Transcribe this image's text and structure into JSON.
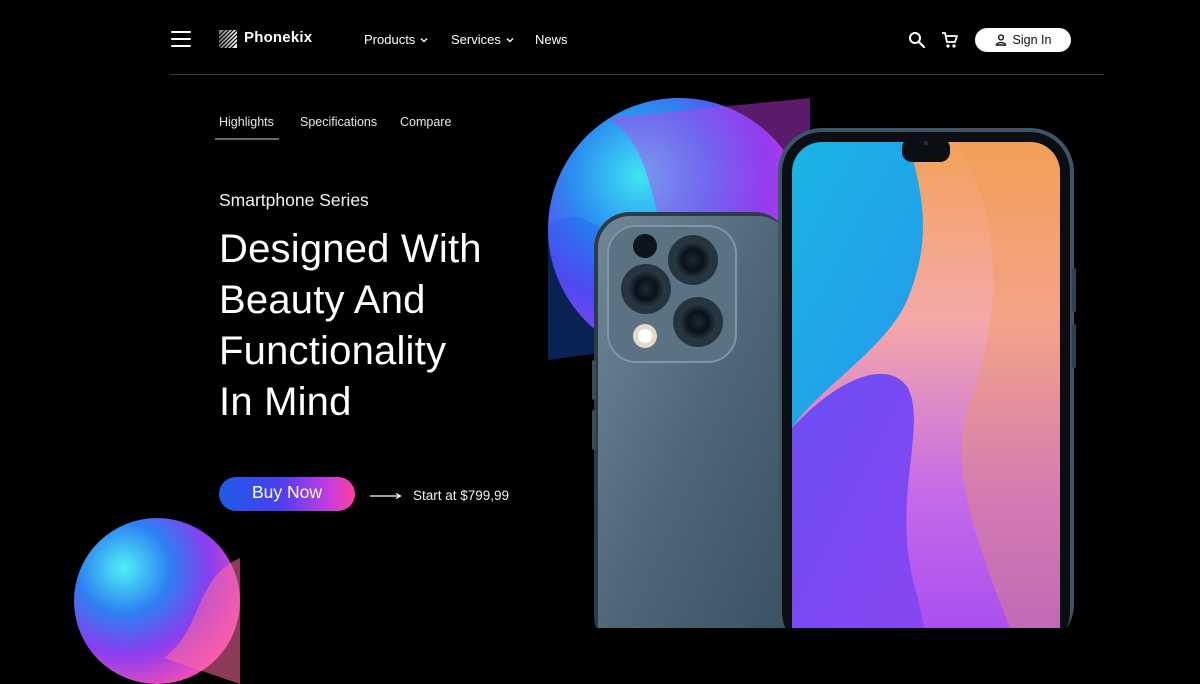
{
  "header": {
    "brand": "Phonekix",
    "nav": [
      {
        "label": "Products",
        "has_dropdown": true
      },
      {
        "label": "Services",
        "has_dropdown": true
      },
      {
        "label": "News",
        "has_dropdown": false
      }
    ],
    "icons": [
      "menu-icon",
      "search-icon",
      "cart-icon",
      "user-icon"
    ],
    "signin_label": "Sign In"
  },
  "tabs": [
    {
      "label": "Highlights",
      "active": true
    },
    {
      "label": "Specifications",
      "active": false
    },
    {
      "label": "Compare",
      "active": false
    }
  ],
  "hero": {
    "eyebrow": "Smartphone Series",
    "headline_lines": [
      "Designed With",
      "Beauty And",
      "Functionality",
      "In Mind"
    ],
    "cta_label": "Buy Now",
    "price_text": "Start at $799,99"
  },
  "colors": {
    "background": "#000000",
    "accent_gradient": [
      "#1d5be8",
      "#c43ce0",
      "#ff3f9a"
    ],
    "phone_frame": "#3e5566"
  }
}
